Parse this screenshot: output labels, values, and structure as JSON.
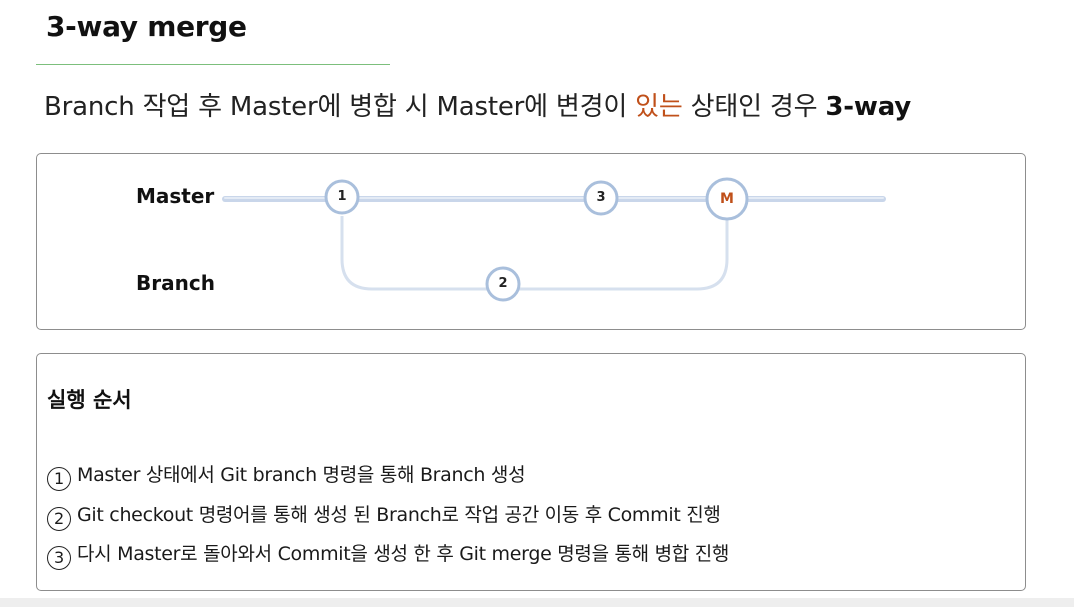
{
  "slide": {
    "title": "3-way merge",
    "subtitle": {
      "part1": "Branch 작업 후 Master에 병합 시 Master에 변경이 ",
      "highlight": "있는",
      "part2": " 상태인 경우 ",
      "bold_end": "3-way"
    }
  },
  "diagram": {
    "lanes": {
      "master": "Master",
      "branch": "Branch"
    },
    "nodes": {
      "commit1": "1",
      "commit2": "2",
      "commit3": "3",
      "merge": "M"
    }
  },
  "steps": {
    "heading": "실행 순서",
    "items": [
      {
        "num": "1",
        "text": "Master 상태에서 Git branch 명령을 통해 Branch 생성"
      },
      {
        "num": "2",
        "text": "Git checkout 명령어를 통해 생성 된 Branch로 작업 공간 이동 후 Commit 진행"
      },
      {
        "num": "3",
        "text": "다시 Master로 돌아와서 Commit을 생성 한 후 Git merge 명령을 통해 병합 진행"
      }
    ]
  },
  "colors": {
    "accent_rule": "#7cbf7c",
    "highlight_text": "#c0501a",
    "line_blue": "#c9d6ea",
    "node_border": "#a9bfdc"
  }
}
